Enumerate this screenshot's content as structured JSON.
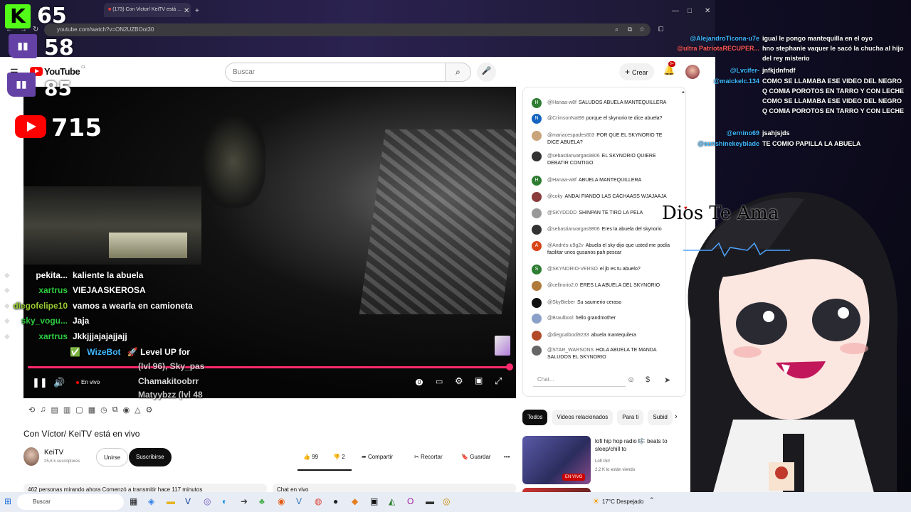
{
  "browser": {
    "tabs": [
      {
        "label": "Tu"
      },
      {
        "label": "(173) Con Victor/ KeiTV está ..."
      }
    ],
    "address": "youtube.com/watch?v=ON2UZBOot30",
    "window_controls": [
      "—",
      "□",
      "✕"
    ]
  },
  "overlay_stats": {
    "kick_count": "65",
    "twitch_count_a": "58",
    "twitch_count_b": "85",
    "youtube_count": "715"
  },
  "youtube": {
    "logo_text": "YouTube",
    "logo_region": "CL",
    "search_placeholder": "Buscar",
    "create_label": "Crear",
    "notif_badge": "9+",
    "player": {
      "live_label": "En vivo",
      "quality_badge": "0"
    },
    "video_title": "Con Víctor/ KeiTV está en vivo",
    "channel": {
      "name": "KeiTV",
      "subs": "25,6 k suscriptores",
      "join_label": "Unirse",
      "subscribed_label": "Suscribirse"
    },
    "actions": {
      "likes": "99",
      "dislikes": "2",
      "share": "Compartir",
      "clip": "Recortar",
      "save": "Guardar",
      "more": "•••"
    },
    "info_bar": "462 personas mirando ahora  Comenzó a transmitir hace 117 minutos",
    "chat_bar": "Chat en vivo",
    "live_chat": {
      "input_placeholder": "Chat...",
      "messages": [
        {
          "initial": "H",
          "color": "#2e7d32",
          "author": "@Hanaa-w8f",
          "text": "SALUDOS ABUELA MANTEQUILLERA"
        },
        {
          "initial": "N",
          "color": "#1565c0",
          "author": "@CrimsonNat98",
          "text": "porque el skynorio te dice abuela?"
        },
        {
          "initial": "",
          "color": "#c9a37a",
          "author": "@mariacespades603",
          "text": "POR QUE EL SKYNORIO TE DICE ABUELA?"
        },
        {
          "initial": "",
          "color": "#333333",
          "author": "@sebastianvargas9806",
          "text": "EL SKYNORIO QUIERE DEBATIR CONTIGO"
        },
        {
          "initial": "H",
          "color": "#2e7d32",
          "author": "@Hanaa-w8f",
          "text": "ABUELA MANTEQUILLERA"
        },
        {
          "initial": "",
          "color": "#8a3b3b",
          "author": "@coky",
          "text": "ANDAI FIANDO LAS CÁCHAASS WJAJAAJA"
        },
        {
          "initial": "",
          "color": "#999999",
          "author": "@SKYDDDD",
          "text": "SHINPAN TE TIRO LA PELA"
        },
        {
          "initial": "",
          "color": "#333333",
          "author": "@sebastianvargas9806",
          "text": "Eres la abuela del skynorio"
        },
        {
          "initial": "A",
          "color": "#d84315",
          "author": "@Andrés-u9g2v",
          "text": "Abuela el sky dijo que usted me podía facilitar unos gusanos pah pescar"
        },
        {
          "initial": "S",
          "color": "#2e7d32",
          "author": "@SKYNORIO-VERSO",
          "text": "el jb es tu abuelo?"
        },
        {
          "initial": "",
          "color": "#b07a3a",
          "author": "@cellnorio2.0",
          "text": "ERES LA ABUELA DEL SKYNORIO"
        },
        {
          "initial": "",
          "color": "#111111",
          "author": "@SkyBieber",
          "text": "Su saumerio ceraso"
        },
        {
          "initial": "",
          "color": "#8aa0c8",
          "author": "@Braulbool",
          "text": "hello grandmother"
        },
        {
          "initial": "",
          "color": "#b24a2a",
          "author": "@diegoalbodi9233",
          "text": "abuela mantequilera"
        },
        {
          "initial": "",
          "color": "#666666",
          "author": "@STAR_WARSONS",
          "text": "HOLA ABUELA TE MANDA SALUDOS EL SKYNORIO"
        }
      ]
    },
    "chips": [
      "Todos",
      "Videos relacionados",
      "Para ti",
      "Subid"
    ],
    "related": {
      "title": "lofi hip hop radio 🎼 beats to sleep/chill to",
      "channel": "Lofi Girl",
      "viewers": "2,2 K lo están viendo",
      "live_badge": "EN VIVO"
    }
  },
  "stream_chat_left": [
    {
      "user": "pekita...",
      "color": "#ffffff",
      "msg": "kaliente la abuela"
    },
    {
      "user": "xartrus",
      "color": "#2ecc40",
      "msg": "VIEJAASKEROSA"
    },
    {
      "user": "diegofelipe10",
      "color": "#9acd32",
      "msg": "vamos a wearla en camioneta"
    },
    {
      "user": "sky_vogu...",
      "color": "#2ecc40",
      "msg": "Jaja"
    },
    {
      "user": "xartrus",
      "color": "#2ecc40",
      "msg": "Jkkjjjajajajjajj"
    }
  ],
  "bot_line": {
    "user": "WizeBot",
    "msg": "🚀 Level UP for",
    "extra": [
      "(lvl 96), Sky_pas",
      "Chamakitoobrr",
      "Matyybzz (lvl 48"
    ]
  },
  "stream_chat_right": [
    {
      "user": "@AlejandroTicona-u7e",
      "msg": "igual le pongo mantequilla en el oyo"
    },
    {
      "user": "@ultra PatriotaRECUPER...",
      "msg": "hno stephanie vaquer le sacó la chucha al hijo del rey misterio"
    },
    {
      "user": "@Lvcifer-",
      "msg": "jnfkjdnfndf"
    },
    {
      "user": "@maickelc.134",
      "msg": "COMO SE LLAMABA ESE VIDEO DEL NEGRO Q COMIA POROTOS EN TARRO Y CON LECHE COMO SE LLAMABA ESE VIDEO DEL NEGRO Q COMIA POROTOS EN TARRO Y CON LECHE"
    },
    {
      "user": "@ernino69",
      "msg": "jsahjsjds"
    },
    {
      "user": "@sunshinekeyblade",
      "msg": "TE COMIO PAPILLA LA ABUELA"
    }
  ],
  "sign_text": "Dios Te Ama",
  "taskbar": {
    "search_label": "Buscar",
    "weather": "17°C  Despejado"
  }
}
